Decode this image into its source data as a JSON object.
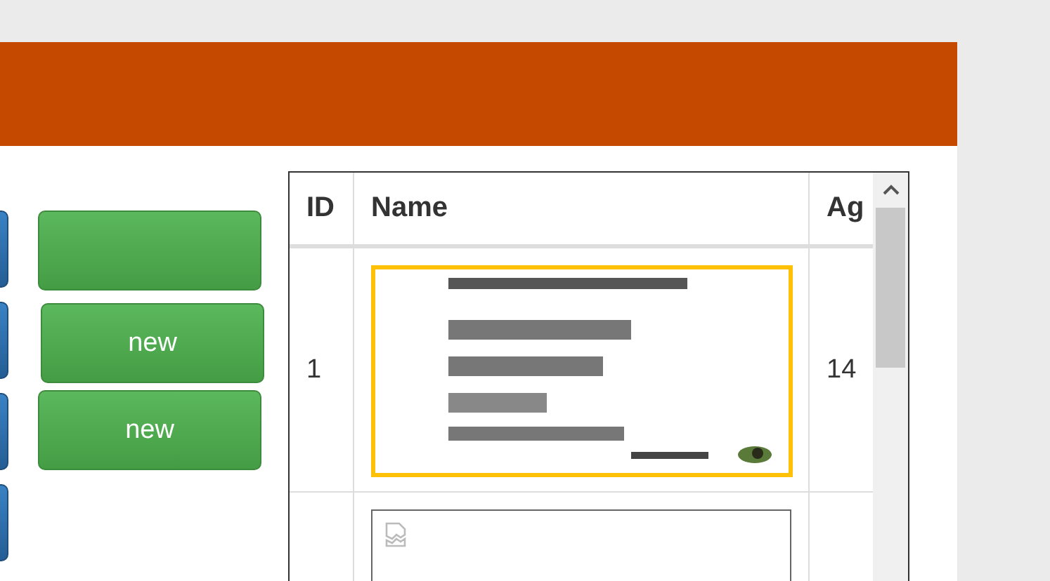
{
  "left_buttons": [
    {
      "kind": "primary"
    },
    {
      "kind": "primary"
    },
    {
      "kind": "primary"
    },
    {
      "kind": "primary"
    }
  ],
  "green_buttons": [
    {
      "kind": "success"
    },
    {
      "kind": "success",
      "label": "new"
    },
    {
      "kind": "success",
      "label": "new"
    }
  ],
  "table": {
    "columns": [
      "ID",
      "Name",
      "Ag"
    ],
    "rows": [
      {
        "id": "1",
        "name": {
          "kind": "picture",
          "selected": true
        },
        "age": "14"
      },
      {
        "name": {
          "kind": "broken-image",
          "selected": false
        }
      }
    ]
  }
}
